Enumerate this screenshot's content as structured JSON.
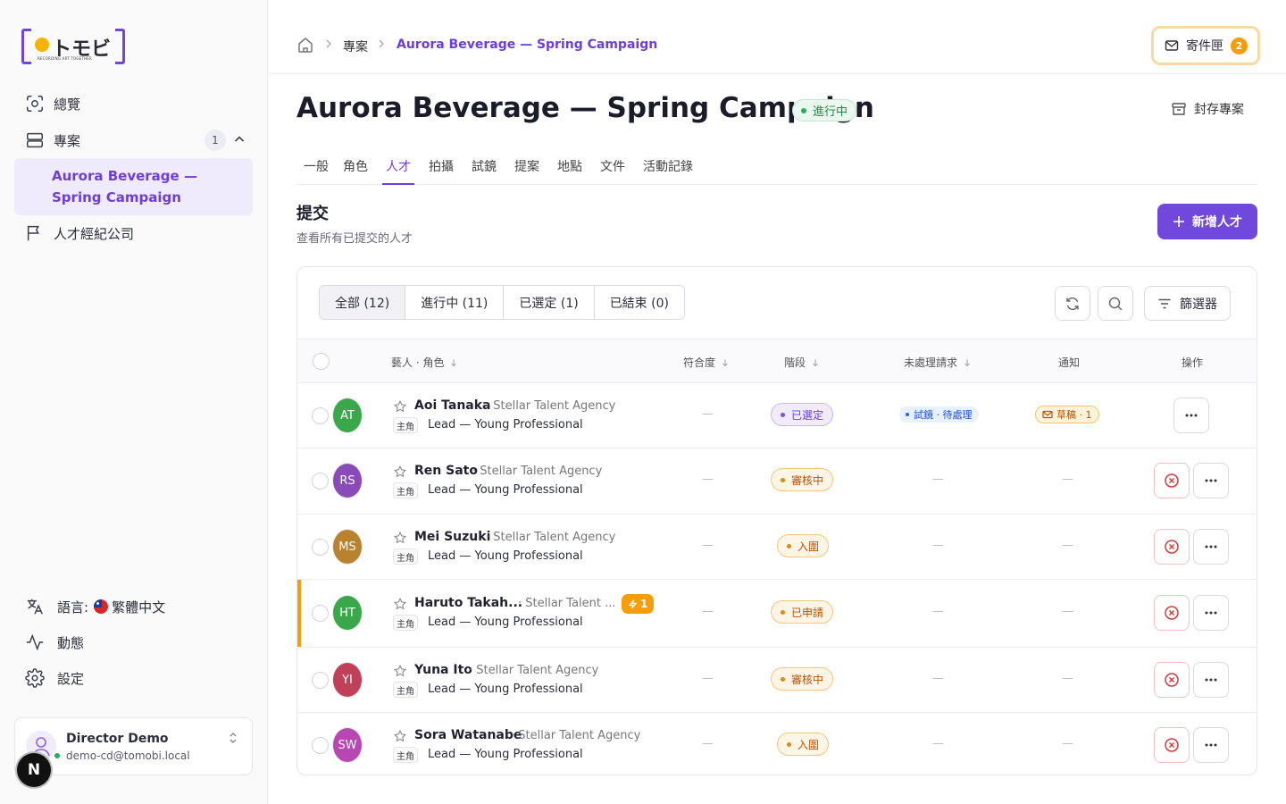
{
  "app": {
    "logo_text": "トモビ",
    "logo_tagline": "RECORDING ART TOGETHER"
  },
  "sidebar": {
    "items": [
      {
        "label": "總覽",
        "icon": "scan-icon"
      },
      {
        "label": "專案",
        "icon": "layers-icon",
        "badge": "1"
      },
      {
        "label": "人才經紀公司",
        "icon": "flag-icon"
      }
    ],
    "active_project": "Aurora Beverage — Spring Campaign",
    "language_label": "語言:",
    "language_value": "繁體中文",
    "activity_label": "動態",
    "settings_label": "設定",
    "user": {
      "name": "Director Demo",
      "email": "demo-cd@tomobi.local"
    },
    "n_badge": "N"
  },
  "topbar": {
    "breadcrumb": [
      "專案",
      "Aurora Beverage — Spring Campaign"
    ],
    "inbox_label": "寄件匣",
    "inbox_count": "2"
  },
  "header": {
    "title": "Aurora Beverage — Spring Campaign",
    "status": "進行中",
    "archive_label": "封存專案"
  },
  "tabs": [
    "一般",
    "角色",
    "人才",
    "拍攝",
    "試鏡",
    "提案",
    "地點",
    "文件",
    "活動記錄"
  ],
  "active_tab": "人才",
  "section": {
    "title": "提交",
    "subtitle": "查看所有已提交的人才",
    "add_button": "新增人才"
  },
  "filters": {
    "segments": [
      "全部 (12)",
      "進行中 (11)",
      "已選定 (1)",
      "已結束 (0)"
    ],
    "active_segment": "全部 (12)",
    "filter_button": "篩選器"
  },
  "table": {
    "columns": [
      "藝人 · 角色",
      "符合度",
      "階段",
      "未處理請求",
      "通知",
      "操作"
    ],
    "rows": [
      {
        "initials": "AT",
        "avatar_color": "#3aa84a",
        "name": "Aoi Tanaka",
        "agency": "· Stellar Talent Agency",
        "role_tag": "主角",
        "role": "Lead — Young Professional",
        "match": "—",
        "stage": "已選定",
        "stage_style": "purple",
        "request": "試鏡 · 待處理",
        "notice": "草稿 · 1",
        "actions": [
          "more"
        ]
      },
      {
        "initials": "RS",
        "avatar_color": "#8a4bb8",
        "name": "Ren Sato",
        "agency": "· Stellar Talent Agency",
        "role_tag": "主角",
        "role": "Lead — Young Professional",
        "match": "—",
        "stage": "審核中",
        "stage_style": "orange",
        "request": "—",
        "notice": "—",
        "actions": [
          "reject",
          "more"
        ]
      },
      {
        "initials": "MS",
        "avatar_color": "#b9822f",
        "name": "Mei Suzuki",
        "agency": "· Stellar Talent Agency",
        "role_tag": "主角",
        "role": "Lead — Young Professional",
        "match": "—",
        "stage": "入圍",
        "stage_style": "orange",
        "request": "—",
        "notice": "—",
        "actions": [
          "reject",
          "more"
        ]
      },
      {
        "initials": "HT",
        "avatar_color": "#3aa84a",
        "name": "Haruto Takah...",
        "agency": "· Stellar Talent ...",
        "urgent": "1",
        "role_tag": "主角",
        "role": "Lead — Young Professional",
        "match": "—",
        "stage": "已申請",
        "stage_style": "orange",
        "request": "—",
        "notice": "—",
        "actions": [
          "reject",
          "more"
        ]
      },
      {
        "initials": "YI",
        "avatar_color": "#c0405a",
        "name": "Yuna Ito",
        "agency": "· Stellar Talent Agency",
        "role_tag": "主角",
        "role": "Lead — Young Professional",
        "match": "—",
        "stage": "審核中",
        "stage_style": "orange",
        "request": "—",
        "notice": "—",
        "actions": [
          "reject",
          "more"
        ]
      },
      {
        "initials": "SW",
        "avatar_color": "#b846b3",
        "name": "Sora Watanabe",
        "agency": "· Stellar Talent Agency",
        "role_tag": "主角",
        "role": "Lead — Young Professional",
        "match": "—",
        "stage": "入圍",
        "stage_style": "orange",
        "request": "—",
        "notice": "—",
        "actions": [
          "reject",
          "more"
        ]
      }
    ]
  },
  "colors": {
    "accent": "#6d3fd8",
    "primary_button": "#7049dc",
    "warning": "#f59e0b",
    "success": "#22b05a",
    "danger": "#d33a3a"
  }
}
